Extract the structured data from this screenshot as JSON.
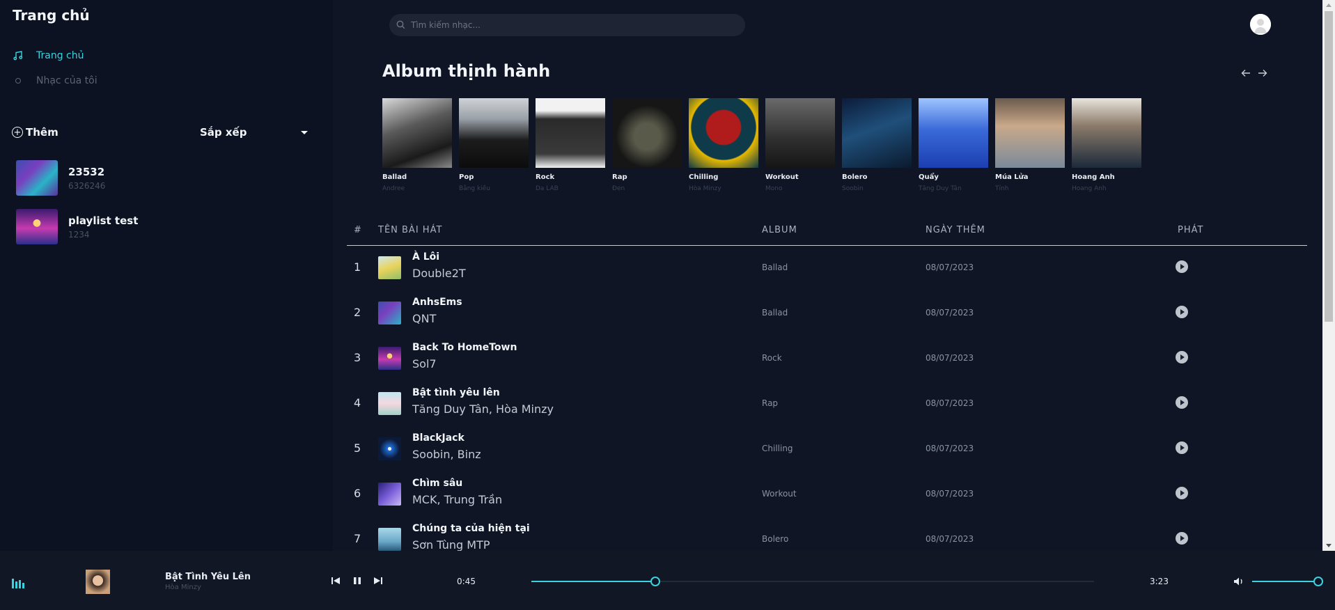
{
  "sidebar": {
    "title": "Trang chủ",
    "nav": [
      {
        "label": "Trang chủ",
        "icon": "music-note-icon",
        "active": true
      },
      {
        "label": "Nhạc của tôi",
        "icon": "circle-icon",
        "active": false
      }
    ],
    "add_label": "Thêm",
    "sort_label": "Sắp xếp",
    "playlists": [
      {
        "name": "23532",
        "sub": "6326246"
      },
      {
        "name": "playlist test",
        "sub": "1234"
      }
    ]
  },
  "search": {
    "placeholder": "Tìm kiếm nhạc..."
  },
  "albums_section": {
    "title": "Album thịnh hành",
    "albums": [
      {
        "name": "Ballad",
        "artist": "Andree"
      },
      {
        "name": "Pop",
        "artist": "Bằng kiều"
      },
      {
        "name": "Rock",
        "artist": "Da LAB"
      },
      {
        "name": "Rap",
        "artist": "Đen"
      },
      {
        "name": "Chilling",
        "artist": "Hòa Minzy"
      },
      {
        "name": "Workout",
        "artist": "Mono"
      },
      {
        "name": "Bolero",
        "artist": "Soobin"
      },
      {
        "name": "Quẩy",
        "artist": "Tăng Duy Tân"
      },
      {
        "name": "Múa Lửa",
        "artist": "Tỉnh"
      },
      {
        "name": "Hoang Anh",
        "artist": "Hoang Anh"
      }
    ]
  },
  "table": {
    "headers": {
      "index": "#",
      "title": "TÊN BÀI HÁT",
      "album": "ALBUM",
      "date": "NGÀY THÊM",
      "play": "PHÁT"
    },
    "rows": [
      {
        "index": "1",
        "title": "À Lôi",
        "artist": "Double2T",
        "album": "Ballad",
        "date": "08/07/2023"
      },
      {
        "index": "2",
        "title": "AnhsEms",
        "artist": "QNT",
        "album": "Ballad",
        "date": "08/07/2023"
      },
      {
        "index": "3",
        "title": "Back To HomeTown",
        "artist": "Sol7",
        "album": "Rock",
        "date": "08/07/2023"
      },
      {
        "index": "4",
        "title": "Bật tình yêu lên",
        "artist": "Tăng Duy Tân, Hòa Minzy",
        "album": "Rap",
        "date": "08/07/2023"
      },
      {
        "index": "5",
        "title": "BlackJack",
        "artist": "Soobin, Binz",
        "album": "Chilling",
        "date": "08/07/2023"
      },
      {
        "index": "6",
        "title": "Chìm sâu",
        "artist": "MCK, Trung Trần",
        "album": "Workout",
        "date": "08/07/2023"
      },
      {
        "index": "7",
        "title": "Chúng ta của hiện tại",
        "artist": "Sơn Tùng MTP",
        "album": "Bolero",
        "date": "08/07/2023"
      }
    ]
  },
  "player": {
    "title": "Bật Tình Yêu Lên",
    "artist": "Hòa Minzy",
    "current_time": "0:45",
    "duration": "3:23",
    "progress": 0.22,
    "volume": 1.0
  },
  "colors": {
    "accent": "#3bd3e0",
    "background": "#0f1524",
    "sidebar": "#0c1221"
  }
}
